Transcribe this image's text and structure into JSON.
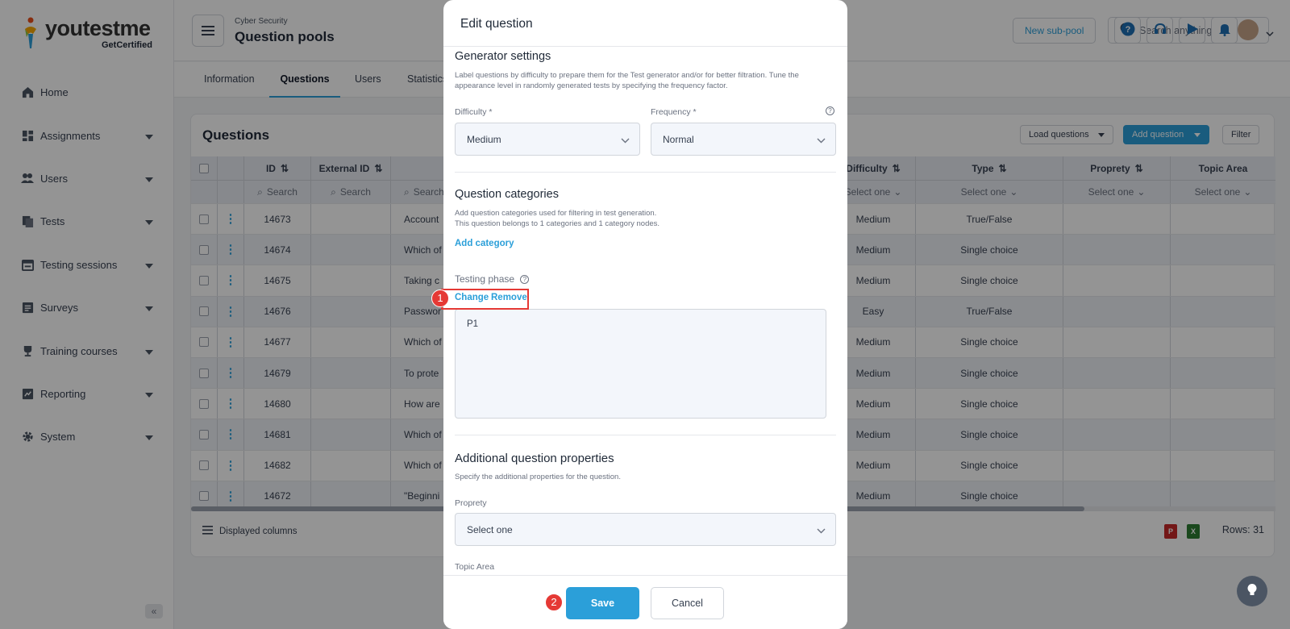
{
  "brand": {
    "logo_text": "youtestme",
    "logo_sub": "GetCertified"
  },
  "sidebar": {
    "items": [
      {
        "label": "Home"
      },
      {
        "label": "Assignments"
      },
      {
        "label": "Users"
      },
      {
        "label": "Tests"
      },
      {
        "label": "Testing sessions"
      },
      {
        "label": "Surveys"
      },
      {
        "label": "Training courses"
      },
      {
        "label": "Reporting"
      },
      {
        "label": "System"
      }
    ],
    "collapse": "«"
  },
  "header": {
    "breadcrumb": "Cyber Security",
    "title": "Question pools",
    "subpool_label": "New sub-pool",
    "search_placeholder": "Search anything"
  },
  "tabs": [
    "Information",
    "Questions",
    "Users",
    "Statistics"
  ],
  "panel": {
    "title": "Questions",
    "load_label": "Load questions",
    "add_label": "Add question",
    "filter_label": "Filter",
    "displayed_columns": "Displayed columns",
    "rows_label": "Rows: 31"
  },
  "table": {
    "headers": {
      "id": "ID",
      "external_id": "External ID",
      "difficulty": "Difficulty",
      "type": "Type",
      "property": "Proprety",
      "topic": "Topic Area"
    },
    "filters": {
      "search": "Search",
      "select": "Select one"
    },
    "rows": [
      {
        "id": "14673",
        "text": "Account",
        "difficulty": "Medium",
        "type": "True/False"
      },
      {
        "id": "14674",
        "text": "Which of",
        "difficulty": "Medium",
        "type": "Single choice"
      },
      {
        "id": "14675",
        "text": "Taking c",
        "difficulty": "Medium",
        "type": "Single choice"
      },
      {
        "id": "14676",
        "text": "Passwor",
        "difficulty": "Easy",
        "type": "True/False"
      },
      {
        "id": "14677",
        "text": "Which of",
        "difficulty": "Medium",
        "type": "Single choice"
      },
      {
        "id": "14679",
        "text": "To prote",
        "difficulty": "Medium",
        "type": "Single choice"
      },
      {
        "id": "14680",
        "text": "How are",
        "difficulty": "Medium",
        "type": "Single choice"
      },
      {
        "id": "14681",
        "text": "Which of",
        "difficulty": "Medium",
        "type": "Single choice"
      },
      {
        "id": "14682",
        "text": "Which of",
        "difficulty": "Medium",
        "type": "Single choice"
      },
      {
        "id": "14672",
        "text": "\"Beginni",
        "difficulty": "Medium",
        "type": "Single choice"
      }
    ]
  },
  "modal": {
    "title": "Edit question",
    "generator": {
      "title": "Generator settings",
      "desc": "Label questions by difficulty to prepare them for the Test generator and/or for better filtration. Tune the appearance level in randomly generated tests by specifying the frequency factor.",
      "difficulty_label": "Difficulty *",
      "difficulty_value": "Medium",
      "frequency_label": "Frequency *",
      "frequency_value": "Normal"
    },
    "categories": {
      "title": "Question categories",
      "desc1": "Add question categories used for filtering in test generation.",
      "desc2": "This question belongs to 1 categories and 1 category nodes.",
      "add_label": "Add category",
      "phase_label": "Testing phase",
      "change_label": "Change",
      "remove_label": "Remove",
      "phase_value": "P1"
    },
    "additional": {
      "title": "Additional question properties",
      "desc": "Specify the additional properties for the question.",
      "property_label": "Proprety",
      "property_value": "Select one",
      "topic_label": "Topic Area"
    },
    "save_label": "Save",
    "cancel_label": "Cancel"
  },
  "annotations": {
    "step1": "1",
    "step2": "2"
  },
  "colors": {
    "accent": "#2b9fd9",
    "highlight": "#e53935"
  }
}
